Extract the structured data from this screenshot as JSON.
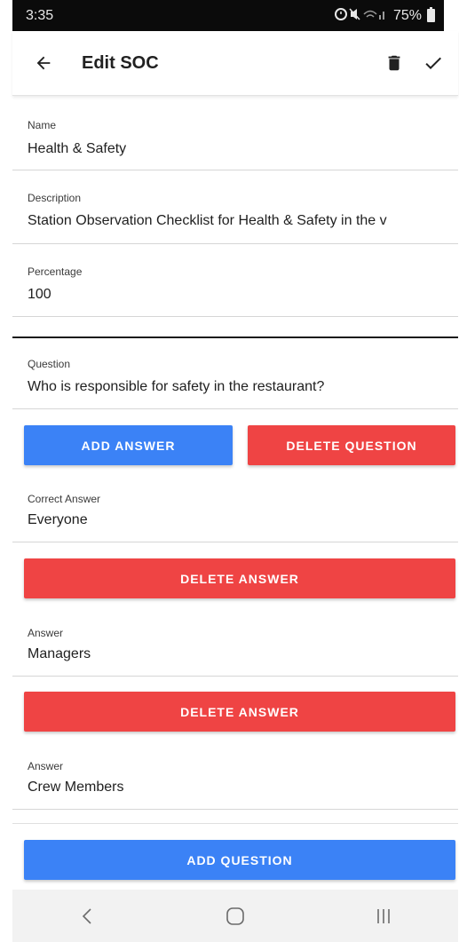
{
  "status_bar": {
    "time": "3:35",
    "icons": "⏰ 🔇 WiFi ll",
    "battery": "75%"
  },
  "app_bar": {
    "title": "Edit SOC",
    "back_icon": "arrow-left",
    "delete_icon": "trash",
    "save_icon": "check"
  },
  "fields": {
    "name": {
      "label": "Name",
      "value": "Health & Safety"
    },
    "description": {
      "label": "Description",
      "value": "Station Observation Checklist for Health & Safety in the v"
    },
    "percentage": {
      "label": "Percentage",
      "value": "100"
    }
  },
  "question": {
    "label": "Question",
    "value": "Who is responsible for safety in the restaurant?",
    "add_answer_label": "ADD ANSWER",
    "delete_question_label": "DELETE QUESTION"
  },
  "answers": [
    {
      "label": "Correct Answer",
      "value": "Everyone",
      "delete_label": "DELETE ANSWER"
    },
    {
      "label": "Answer",
      "value": "Managers",
      "delete_label": "DELETE ANSWER"
    },
    {
      "label": "Answer",
      "value": "Crew Members"
    }
  ],
  "footer": {
    "add_question_label": "ADD QUESTION"
  },
  "colors": {
    "primary_blue": "#3b82f6",
    "danger_red": "#ef4444"
  }
}
